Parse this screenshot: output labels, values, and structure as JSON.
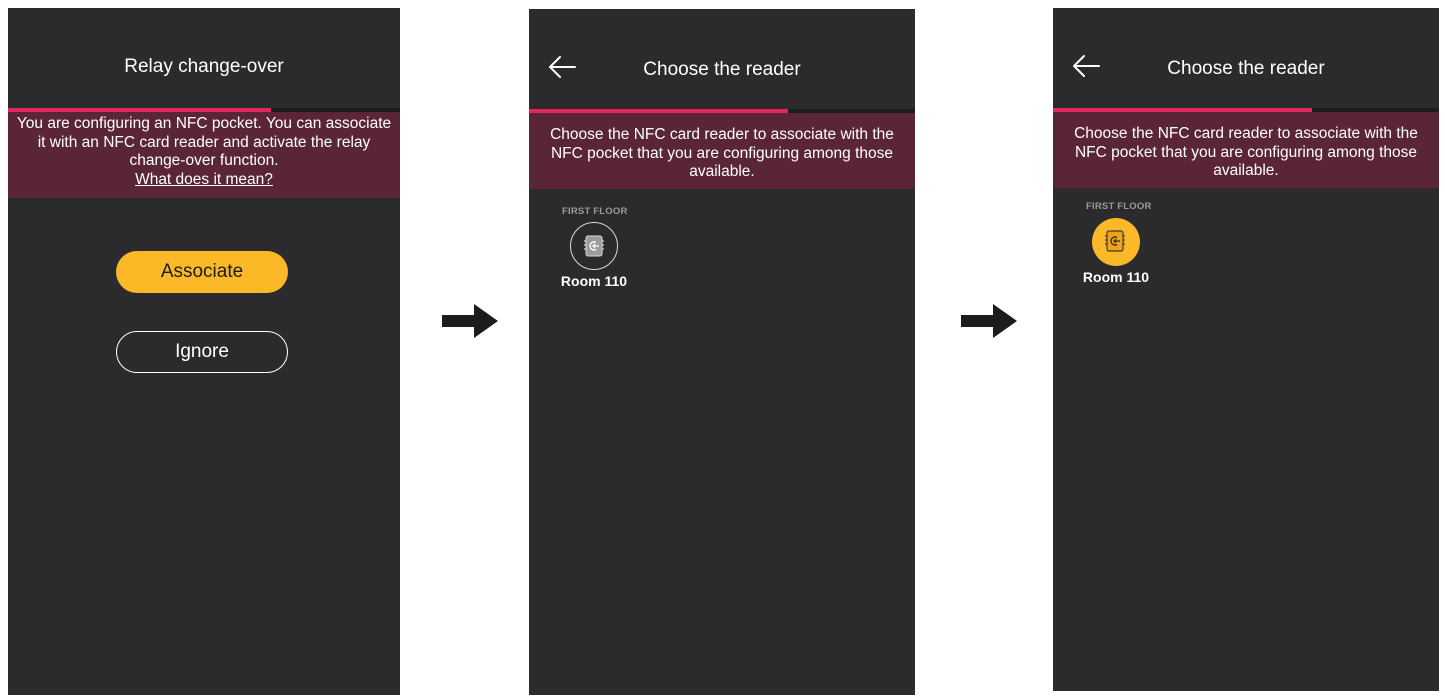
{
  "screen1": {
    "title": "Relay change-over",
    "progress": 0.67,
    "banner_text": "You are configuring an NFC pocket. You can associate it with an NFC card reader and activate the relay change-over function.",
    "banner_link": "What does it mean?",
    "associate_label": "Associate",
    "ignore_label": "Ignore"
  },
  "screen2": {
    "title": "Choose the reader",
    "progress": 0.67,
    "banner_text": "Choose the NFC card reader to associate with the NFC pocket that you are configuring among those available.",
    "group_label": "FIRST FLOOR",
    "device_label": "Room 110",
    "device_selected": false
  },
  "screen3": {
    "title": "Choose the reader",
    "progress": 0.67,
    "banner_text": "Choose the NFC card reader to associate with the NFC pocket that you are configuring among those available.",
    "group_label": "FIRST FLOOR",
    "device_label": "Room 110",
    "device_selected": true
  },
  "colors": {
    "screen_bg": "#2b2b2d",
    "accent": "#e0285f",
    "banner": "#5b2538",
    "primary_button": "#fbb827"
  },
  "icons": [
    "back-arrow-icon",
    "nfc-reader-icon",
    "right-arrow-icon"
  ]
}
